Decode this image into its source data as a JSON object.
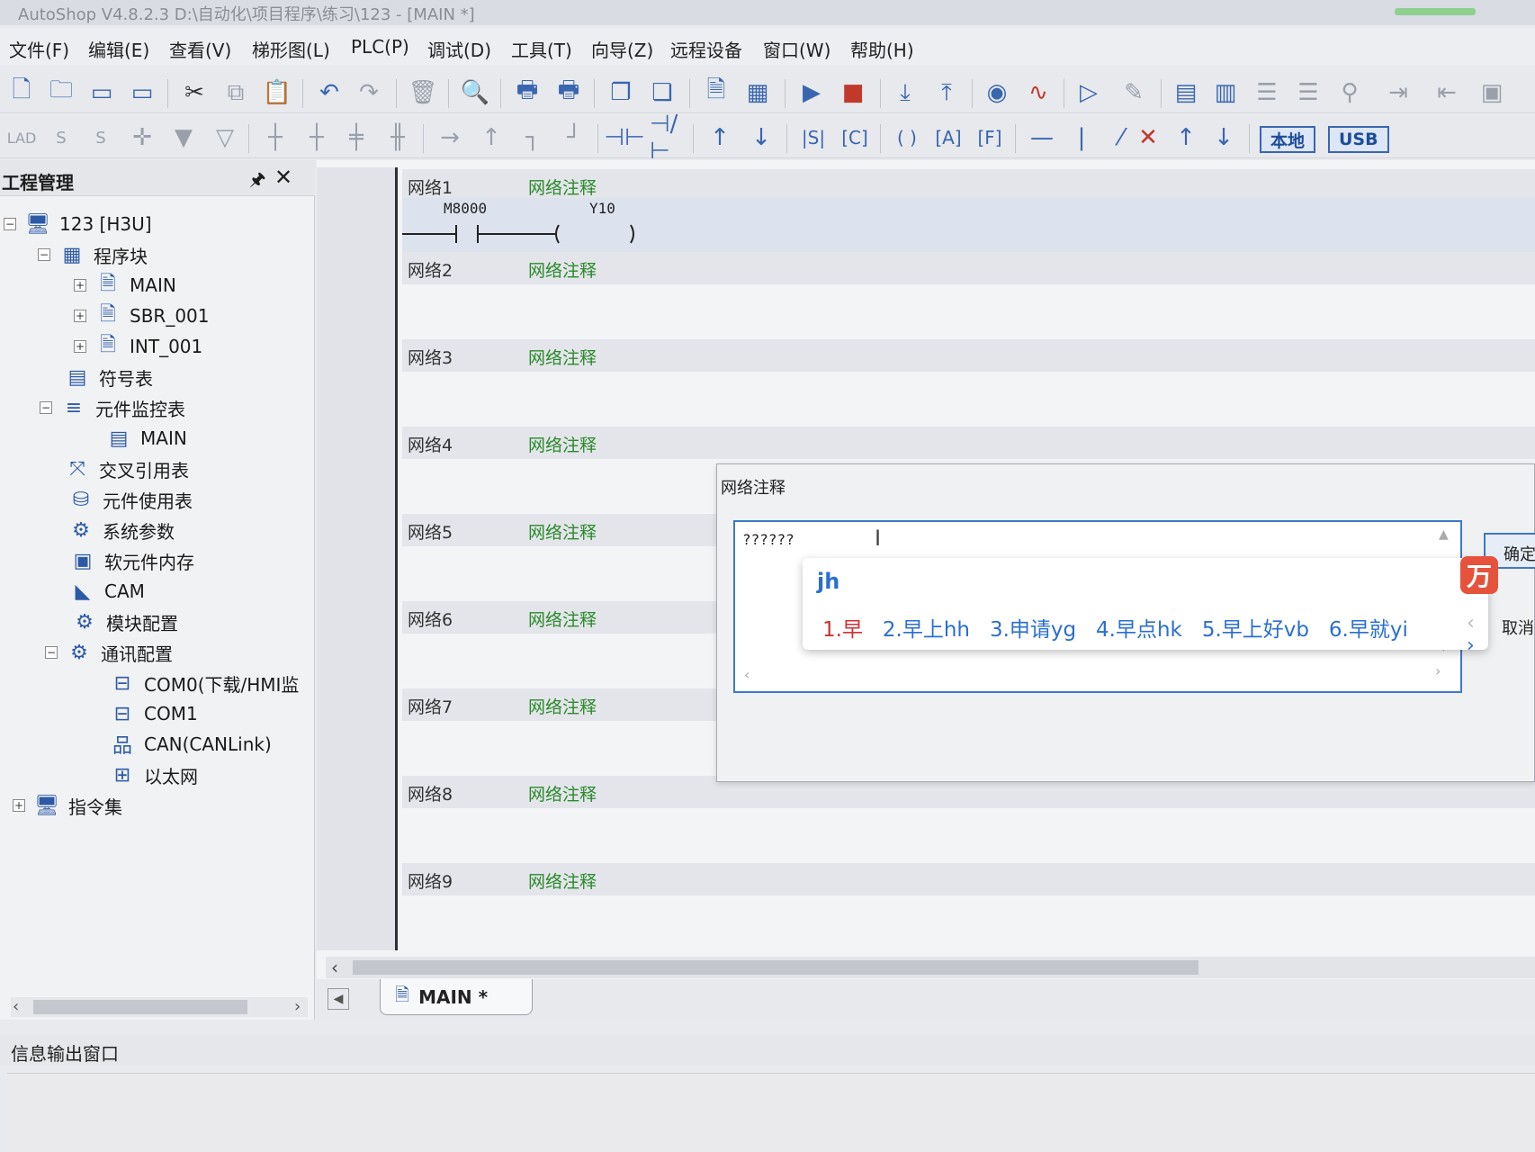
{
  "titlebar": {
    "title": "AutoShop V4.8.2.3  D:\\自动化\\项目程序\\练习\\123 - [MAIN *]"
  },
  "menu": [
    "文件(F)",
    "编辑(E)",
    "查看(V)",
    "梯形图(L)",
    "PLC(P)",
    "调试(D)",
    "工具(T)",
    "向导(Z)",
    "远程设备",
    "窗口(W)",
    "帮助(H)"
  ],
  "toolbar": {
    "row1_icons": [
      "new-icon",
      "open-icon",
      "save-icon",
      "save-all-icon",
      "cut-icon",
      "copy-icon",
      "paste-icon",
      "undo-icon",
      "redo-icon",
      "delete-icon",
      "find-icon",
      "print-preview-icon",
      "print-icon",
      "window-icon",
      "window-list-icon",
      "doc-icon",
      "table-icon",
      "run-icon",
      "stop-icon",
      "download-icon",
      "upload-icon",
      "monitor-icon",
      "trace-icon",
      "debug-run-icon",
      "edit-icon",
      "compile-icon",
      "compile-all-icon",
      "align-left-icon",
      "align-right-icon",
      "plc-test-icon",
      "login-icon",
      "logout-icon",
      "panel-icon"
    ],
    "row2_icons": [
      "ladder-mode-icon",
      "sfc-mode-icon",
      "stl-mode-icon",
      "cross-icon",
      "down-arrow-icon",
      "down-outline-icon",
      "branch1-icon",
      "branch2-icon",
      "branch3-icon",
      "branch4-icon",
      "hline-icon",
      "vline-icon",
      "corner1-icon",
      "corner2-icon",
      "no-contact-icon",
      "nc-contact-icon",
      "rising-contact-icon",
      "falling-contact-icon",
      "set-contact-icon",
      "counter-contact-icon",
      "coil-icon",
      "app-instruction-icon",
      "function-icon",
      "hline2-icon",
      "vline2-icon",
      "diag-icon",
      "cross2-icon",
      "up-icon",
      "down-icon"
    ],
    "local_label": "本地",
    "usb_label": "USB"
  },
  "sidebar": {
    "title": "工程管理",
    "pin": "🖈",
    "close": "✕",
    "tree": [
      {
        "label": "123 [H3U]",
        "icon": "computer-icon",
        "expander": "−"
      },
      {
        "label": "程序块",
        "icon": "blocks-icon",
        "expander": "−"
      },
      {
        "label": "MAIN",
        "icon": "program-icon",
        "expander": "+"
      },
      {
        "label": "SBR_001",
        "icon": "subroutine-icon",
        "expander": "+"
      },
      {
        "label": "INT_001",
        "icon": "interrupt-icon",
        "expander": "+"
      },
      {
        "label": "符号表",
        "icon": "symbol-table-icon",
        "expander": ""
      },
      {
        "label": "元件监控表",
        "icon": "monitor-table-icon",
        "expander": "−"
      },
      {
        "label": "MAIN",
        "icon": "table-icon",
        "expander": ""
      },
      {
        "label": "交叉引用表",
        "icon": "cross-ref-icon",
        "expander": ""
      },
      {
        "label": "元件使用表",
        "icon": "database-icon",
        "expander": ""
      },
      {
        "label": "系统参数",
        "icon": "system-params-icon",
        "expander": ""
      },
      {
        "label": "软元件内存",
        "icon": "memory-icon",
        "expander": ""
      },
      {
        "label": "CAM",
        "icon": "cam-icon",
        "expander": ""
      },
      {
        "label": "模块配置",
        "icon": "module-config-icon",
        "expander": ""
      },
      {
        "label": "通讯配置",
        "icon": "comm-config-icon",
        "expander": "−"
      },
      {
        "label": "COM0(下载/HMI监",
        "icon": "serial-port-icon",
        "expander": ""
      },
      {
        "label": "COM1",
        "icon": "serial-port-icon",
        "expander": ""
      },
      {
        "label": "CAN(CANLink)",
        "icon": "network-icon",
        "expander": ""
      },
      {
        "label": "以太网",
        "icon": "ethernet-icon",
        "expander": ""
      },
      {
        "label": "指令集",
        "icon": "computer-icon",
        "expander": "+"
      }
    ]
  },
  "editor": {
    "networks": [
      {
        "name": "网络1",
        "comment": "网络注释"
      },
      {
        "name": "网络2",
        "comment": "网络注释"
      },
      {
        "name": "网络3",
        "comment": "网络注释"
      },
      {
        "name": "网络4",
        "comment": "网络注释"
      },
      {
        "name": "网络5",
        "comment": "网络注释"
      },
      {
        "name": "网络6",
        "comment": "网络注释"
      },
      {
        "name": "网络7",
        "comment": "网络注释"
      },
      {
        "name": "网络8",
        "comment": "网络注释"
      },
      {
        "name": "网络9",
        "comment": "网络注释"
      }
    ],
    "contact_label": "M8000",
    "coil_label": "Y10"
  },
  "tab": {
    "label": "MAIN *"
  },
  "info_panel": {
    "title": "信息输出窗口"
  },
  "dialog": {
    "title": "网络注释",
    "input_value": "??????",
    "ok_label": "确定",
    "cancel_label": "取消"
  },
  "ime": {
    "composition": "jh",
    "candidates": [
      "1.早",
      "2.早上hh",
      "3.申请yg",
      "4.早点hk",
      "5.早上好vb",
      "6.早就yi"
    ],
    "nav_prev": "‹",
    "nav_next": "›",
    "logo": "万"
  },
  "colors": {
    "accent": "#3d79c9",
    "comment_green": "#2a8a2a",
    "ime_blue": "#2a6fd0",
    "ime_red": "#d03030"
  }
}
